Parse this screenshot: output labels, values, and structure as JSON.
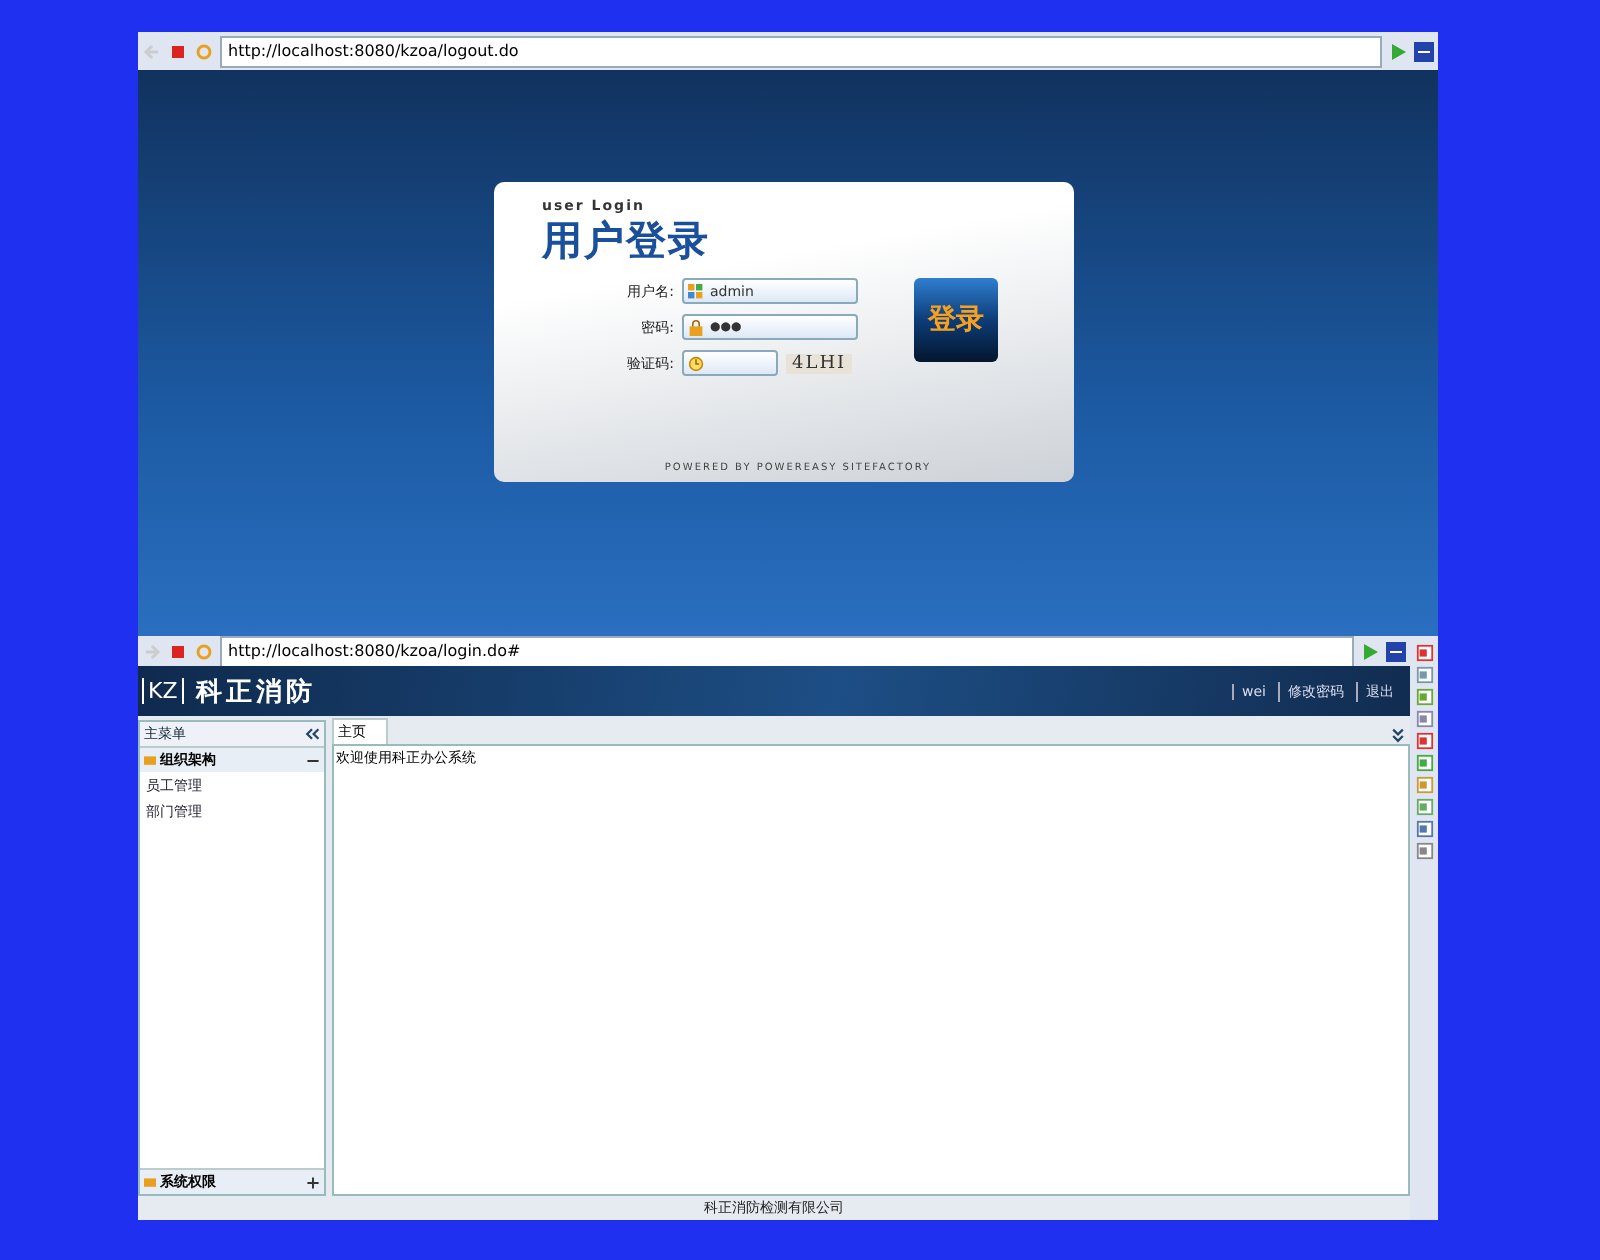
{
  "login_window": {
    "address_bar": {
      "url": "http://localhost:8080/kzoa/logout.do"
    },
    "login_card": {
      "subtitle": "user Login",
      "title": "用户登录",
      "fields": [
        {
          "kind": "text",
          "label": "用户名:",
          "value": "admin"
        },
        {
          "kind": "password",
          "label": "密码:",
          "value": "●●●"
        },
        {
          "kind": "captcha",
          "label": "验证码:",
          "captcha_text": "4LHI"
        }
      ],
      "login_button": "登录",
      "footer": "POWERED BY POWEREASY SITEFACTORY"
    }
  },
  "main_window": {
    "address_bar": {
      "url": "http://localhost:8080/kzoa/login.do#"
    },
    "header": {
      "logo_mark": "KZ",
      "logo_text": "科正消防",
      "links": [
        "wei",
        "修改密码",
        "退出"
      ]
    },
    "sidebar": {
      "title": "主菜单",
      "sections": [
        {
          "title": "组织架构",
          "expanded": true,
          "children": [
            {
              "label": "员工管理"
            },
            {
              "label": "部门管理"
            }
          ]
        },
        {
          "title": "系统权限",
          "expanded": false
        }
      ]
    },
    "tabs": [
      {
        "label": "主页",
        "selected": true
      }
    ],
    "content": "欢迎使用科正办公系统",
    "footer": "科正消防检测有限公司"
  }
}
